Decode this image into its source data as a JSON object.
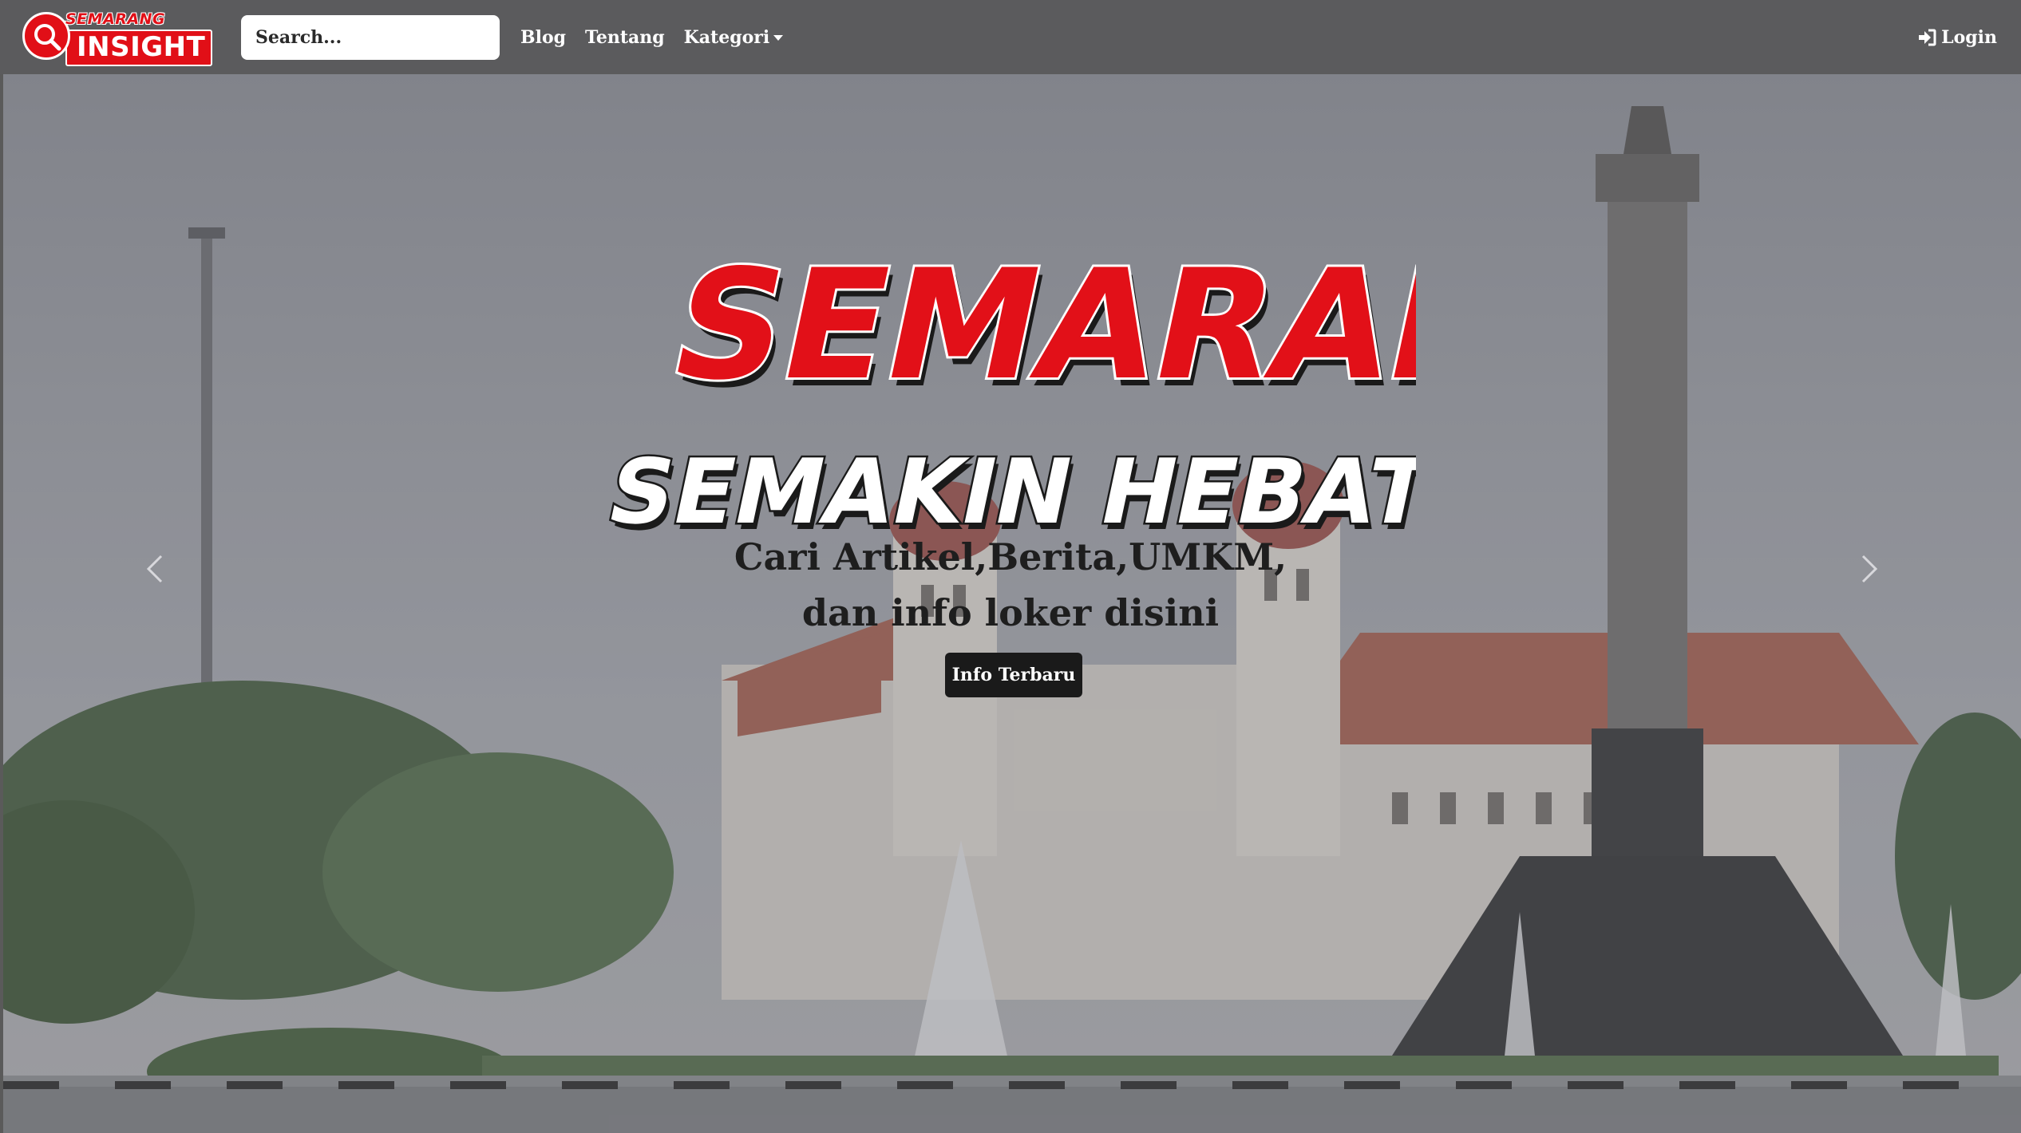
{
  "brand": {
    "logo_top": "SEMARANG",
    "logo_main": "INSIGHT"
  },
  "navbar": {
    "search_placeholder": "Search...",
    "links": [
      "Blog",
      "Tentang",
      "Kategori"
    ],
    "login_label": "Login"
  },
  "hero": {
    "headline_line1": "SEMARANG",
    "headline_line2": "SEMAKIN HEBAT!",
    "tagline_line1": "Cari Artikel,Berita,UMKM,",
    "tagline_line2": "dan info loker disini",
    "cta_label": "Info Terbaru"
  },
  "colors": {
    "navbar_bg": "#5b5b5d",
    "brand_red": "#e10f17",
    "cta_bg": "#1a1a1a"
  },
  "icons": {
    "search_logo": "magnifier-icon",
    "login": "sign-in-icon",
    "prev": "chevron-left-icon",
    "next": "chevron-right-icon",
    "dropdown": "caret-down-icon"
  }
}
